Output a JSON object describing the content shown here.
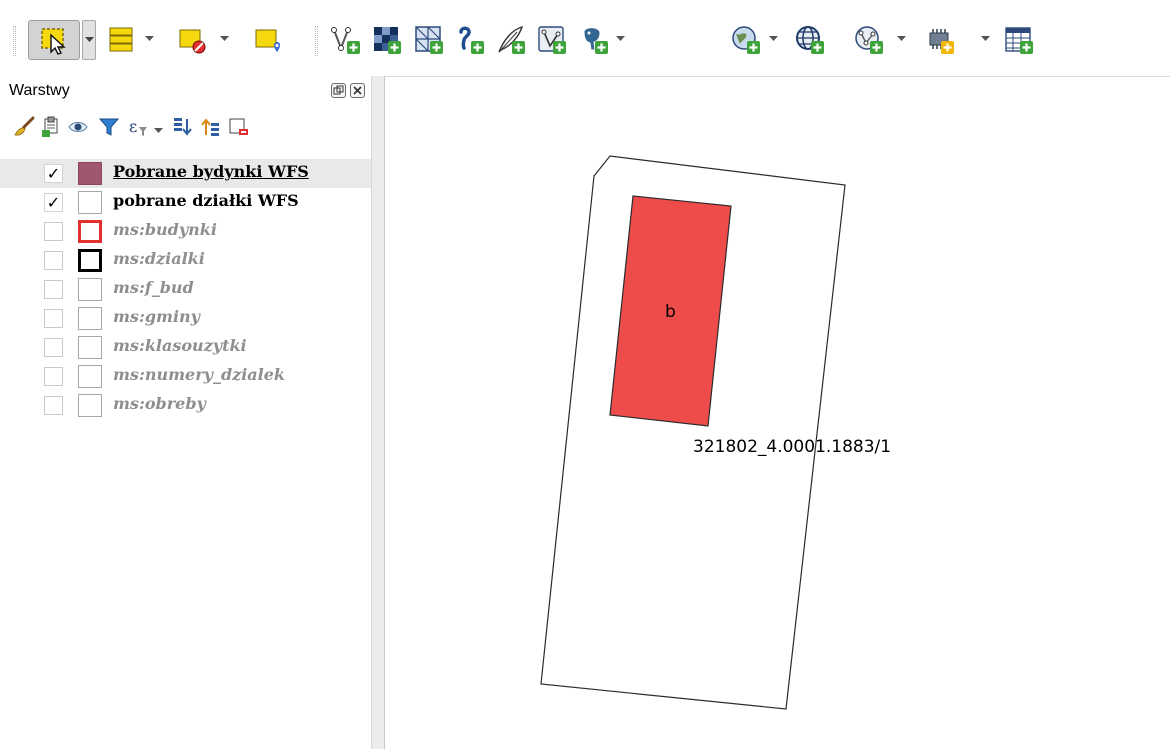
{
  "toolbar": {
    "buttons": [
      {
        "name": "select-features-icon"
      },
      {
        "name": "attribute-table-select-icon"
      },
      {
        "name": "deselect-features-icon"
      },
      {
        "name": "identify-location-icon"
      },
      {
        "name": "new-vector-layer-icon"
      },
      {
        "name": "add-raster-layer-icon"
      },
      {
        "name": "add-mesh-layer-icon"
      },
      {
        "name": "add-delimited-text-icon"
      },
      {
        "name": "new-shapefile-icon"
      },
      {
        "name": "add-spatialite-icon"
      },
      {
        "name": "add-postgis-icon"
      },
      {
        "name": "add-wms-icon"
      },
      {
        "name": "add-wfs-icon"
      },
      {
        "name": "add-wcs-icon"
      },
      {
        "name": "add-virtual-layer-icon"
      },
      {
        "name": "open-attribute-table-icon"
      }
    ]
  },
  "layers_panel": {
    "title": "Warstwy",
    "tools": [
      {
        "name": "styling-brush-icon"
      },
      {
        "name": "add-group-icon"
      },
      {
        "name": "manage-visibility-icon"
      },
      {
        "name": "filter-legend-icon"
      },
      {
        "name": "filter-expression-icon"
      },
      {
        "name": "expand-all-icon"
      },
      {
        "name": "collapse-all-icon"
      },
      {
        "name": "remove-layer-icon"
      }
    ],
    "layers": [
      {
        "label": "Pobrane bydynki WFS",
        "checked": true,
        "active": true,
        "selected": true,
        "swatch_fill": "#a05671",
        "swatch_border": "#8a4560"
      },
      {
        "label": "pobrane działki WFS",
        "checked": true,
        "active": true,
        "selected": false,
        "swatch_fill": "#ffffff",
        "swatch_border": "#a8a8a8"
      },
      {
        "label": "ms:budynki",
        "checked": false,
        "active": false,
        "selected": false,
        "swatch_fill": "#ffffff",
        "swatch_border": "#e0302f"
      },
      {
        "label": "ms:dzialki",
        "checked": false,
        "active": false,
        "selected": false,
        "swatch_fill": "#ffffff",
        "swatch_border": "#000000"
      },
      {
        "label": "ms:f_bud",
        "checked": false,
        "active": false,
        "selected": false,
        "swatch_fill": "#ffffff",
        "swatch_border": "#a8a8a8"
      },
      {
        "label": "ms:gminy",
        "checked": false,
        "active": false,
        "selected": false,
        "swatch_fill": "#ffffff",
        "swatch_border": "#a8a8a8"
      },
      {
        "label": "ms:klasouzytki",
        "checked": false,
        "active": false,
        "selected": false,
        "swatch_fill": "#ffffff",
        "swatch_border": "#a8a8a8"
      },
      {
        "label": "ms:numery_dzialek",
        "checked": false,
        "active": false,
        "selected": false,
        "swatch_fill": "#ffffff",
        "swatch_border": "#a8a8a8"
      },
      {
        "label": "ms:obreby",
        "checked": false,
        "active": false,
        "selected": false,
        "swatch_fill": "#ffffff",
        "swatch_border": "#a8a8a8"
      }
    ]
  },
  "map": {
    "building_label": "b",
    "parcel_label": "321802_4.0001.1883/1",
    "building_color": "#ee4c4b",
    "parcel_stroke": "#2b2b2b"
  }
}
